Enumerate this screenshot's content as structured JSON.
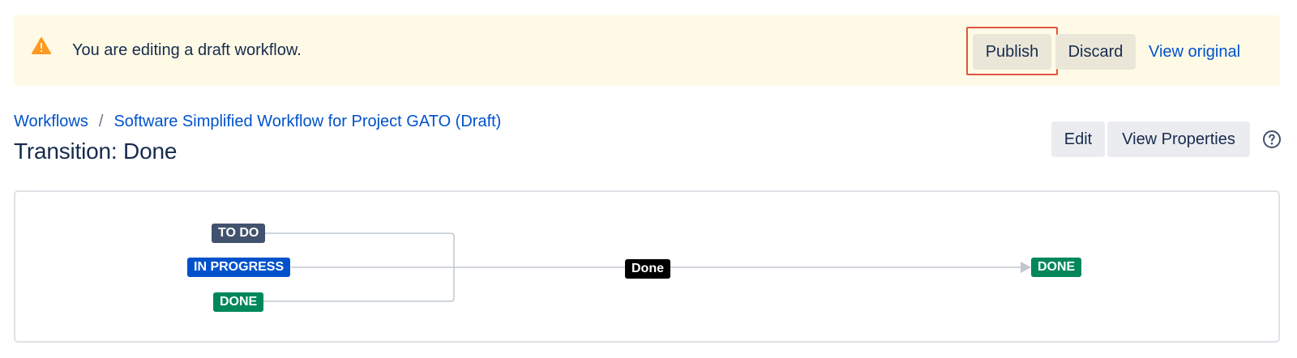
{
  "banner": {
    "icon": "warning-icon",
    "message": "You are editing a draft workflow.",
    "publish_label": "Publish",
    "discard_label": "Discard",
    "view_original_label": "View original",
    "background": "#fffae6",
    "highlight_color": "#e5533d"
  },
  "breadcrumb": {
    "items": [
      "Workflows",
      "Software Simplified Workflow for Project GATO (Draft)"
    ],
    "separator": "/"
  },
  "page": {
    "title": "Transition: Done"
  },
  "toolbar": {
    "edit_label": "Edit",
    "view_properties_label": "View Properties",
    "help_icon": "help-icon"
  },
  "diagram": {
    "from_statuses": [
      {
        "label": "TO DO",
        "color": "#42526e"
      },
      {
        "label": "IN PROGRESS",
        "color": "#0052cc"
      },
      {
        "label": "DONE",
        "color": "#00875a"
      }
    ],
    "transition": {
      "label": "Done",
      "color": "#000000"
    },
    "to_status": {
      "label": "DONE",
      "color": "#00875a"
    },
    "line_color": "#c1c7d0"
  }
}
